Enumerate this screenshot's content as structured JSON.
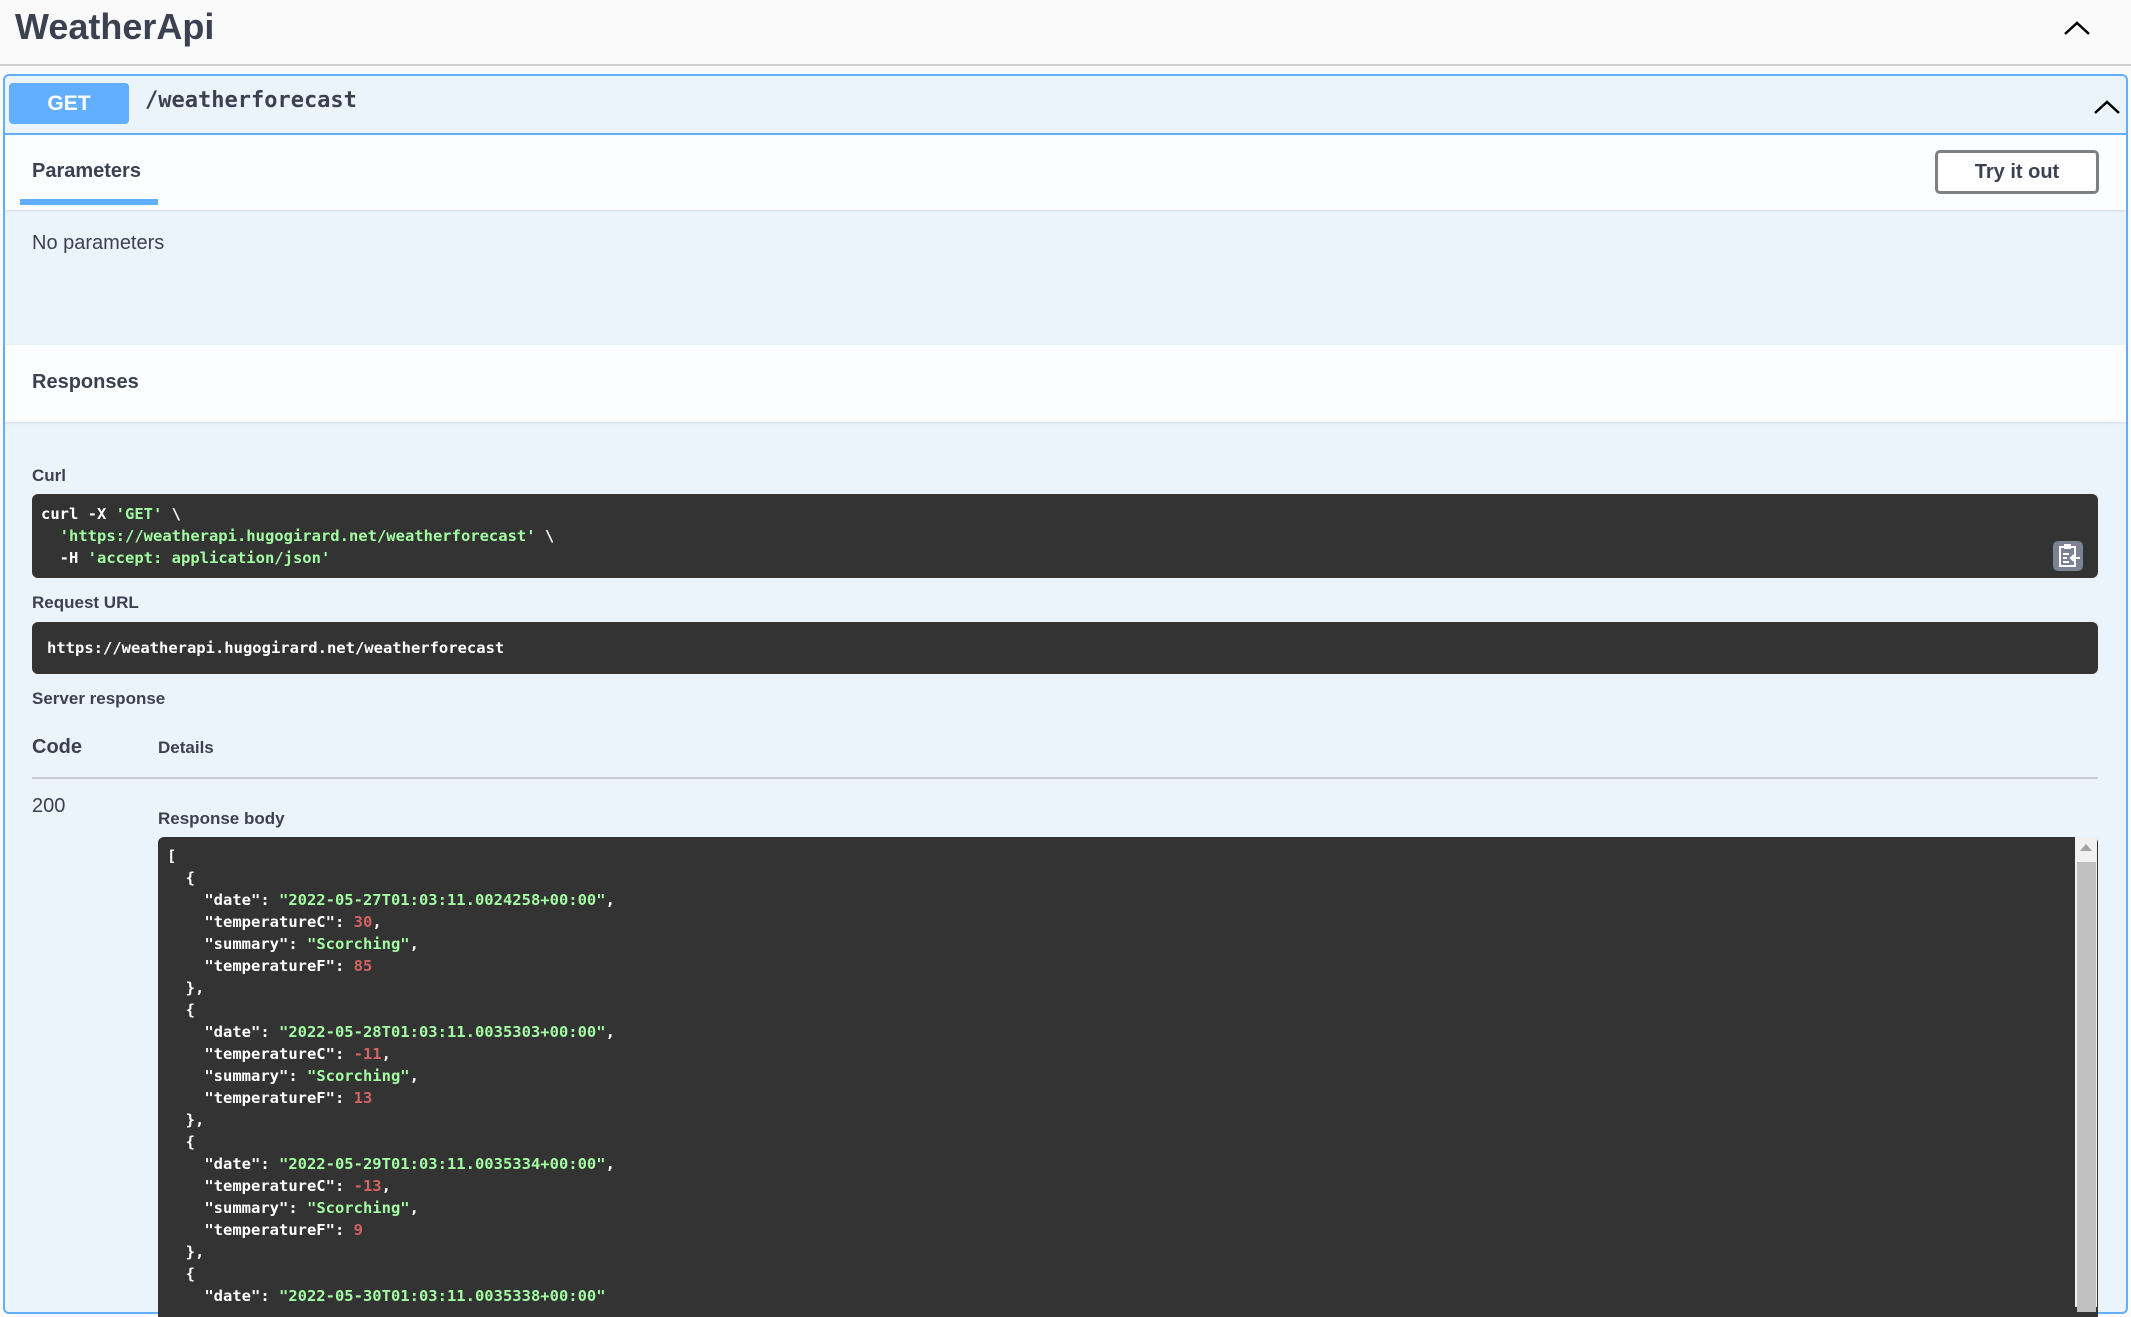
{
  "header": {
    "title": "WeatherApi"
  },
  "operation": {
    "method": "GET",
    "path": "/weatherforecast"
  },
  "tabs": {
    "parameters": "Parameters",
    "try_it_out": "Try it out"
  },
  "parameters": {
    "empty": "No parameters"
  },
  "responses": {
    "title": "Responses"
  },
  "curl": {
    "label": "Curl",
    "line1_cmd": "curl -X ",
    "line1_str": "'GET'",
    "line1_end": " \\",
    "line2_pre": "  ",
    "line2_str": "'https://weatherapi.hugogirard.net/weatherforecast'",
    "line2_end": " \\",
    "line3_pre": "  -H ",
    "line3_str": "'accept: application/json'"
  },
  "request_url": {
    "label": "Request URL",
    "value": "https://weatherapi.hugogirard.net/weatherforecast"
  },
  "server_response": {
    "label": "Server response",
    "code_header": "Code",
    "details_header": "Details",
    "code": "200",
    "body_label": "Response body"
  },
  "response_body": [
    {
      "date": "\"2022-05-27T01:03:11.0024258+00:00\"",
      "temperatureC": "30",
      "summary": "\"Scorching\"",
      "temperatureF": "85"
    },
    {
      "date": "\"2022-05-28T01:03:11.0035303+00:00\"",
      "temperatureC": "-11",
      "summary": "\"Scorching\"",
      "temperatureF": "13"
    },
    {
      "date": "\"2022-05-29T01:03:11.0035334+00:00\"",
      "temperatureC": "-13",
      "summary": "\"Scorching\"",
      "temperatureF": "9"
    },
    {
      "date": "\"2022-05-30T01:03:11.0035338+00:00\""
    }
  ],
  "colors": {
    "get": "#61affe",
    "code_bg": "#333333",
    "string": "#a2fca2",
    "number": "#d36363"
  }
}
